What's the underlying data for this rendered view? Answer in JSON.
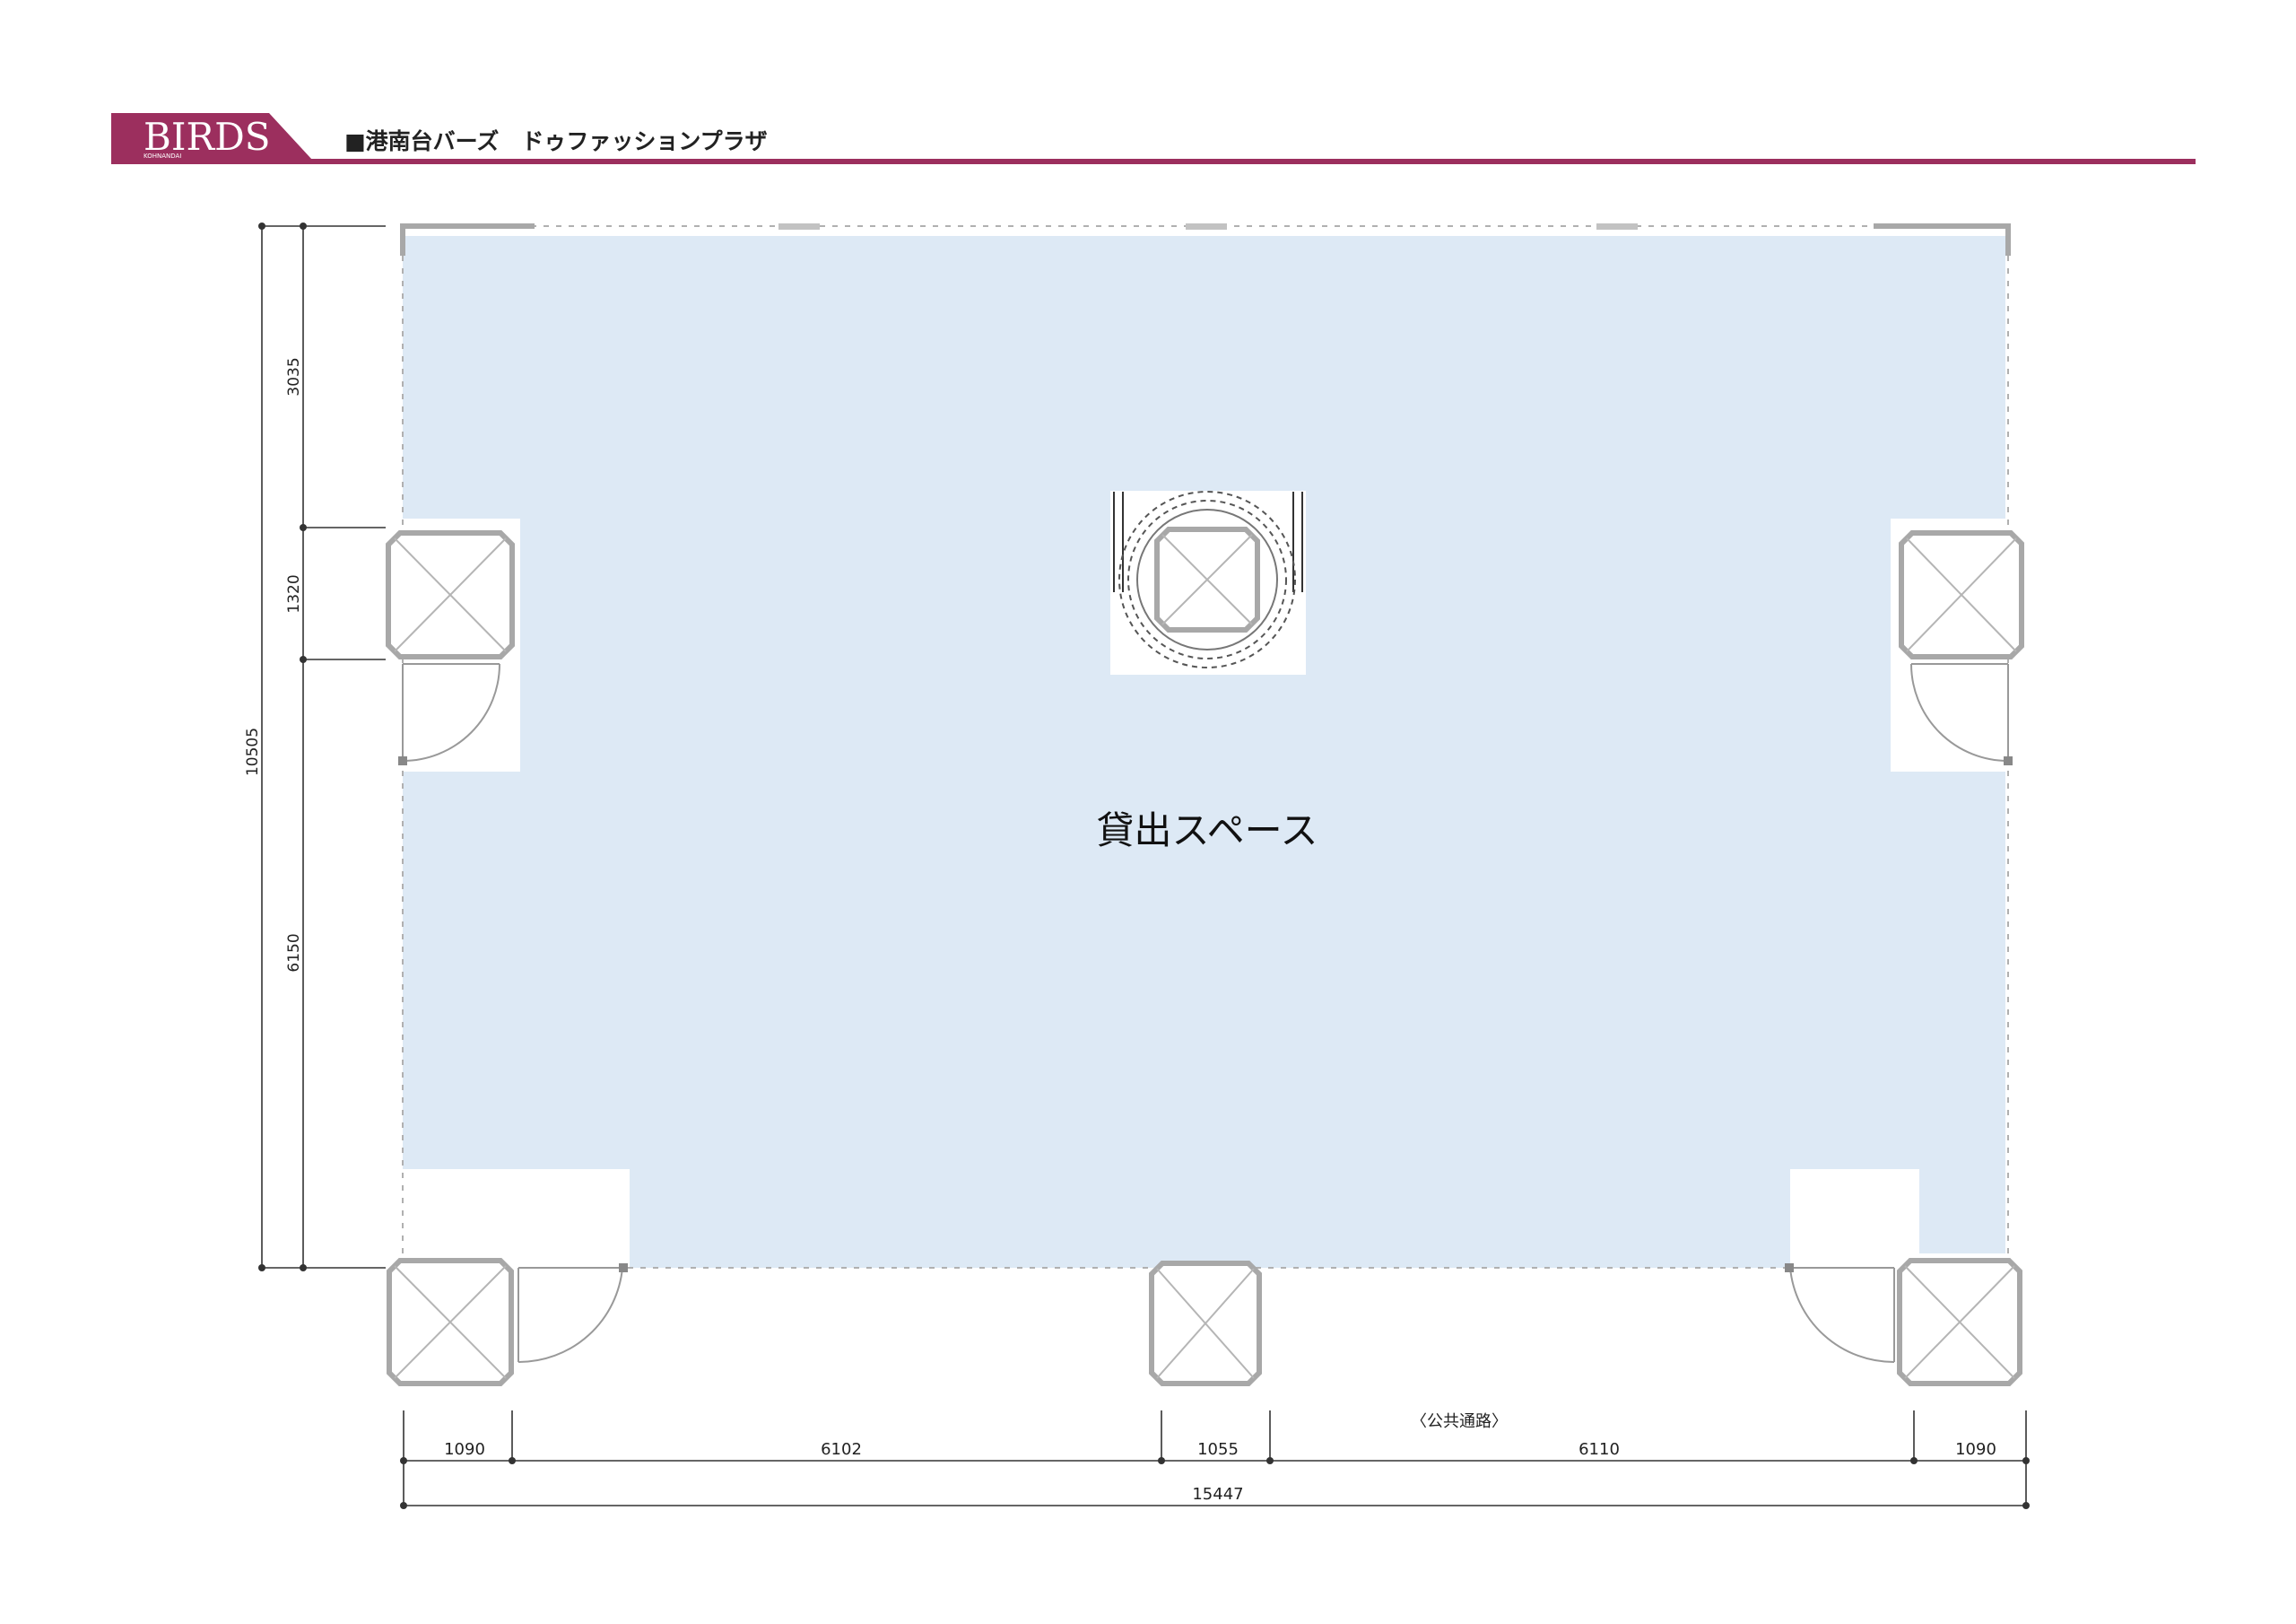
{
  "header": {
    "logo_text": "BIRDS",
    "logo_subtext": "KOHNANDAI",
    "title": "■港南台バーズ　ドゥファッションプラザ"
  },
  "colors": {
    "brand": "#9c2f5e",
    "floor": "#dde9f5",
    "pillar_stroke": "#a8a8a8"
  },
  "room": {
    "label": "貸出スペース"
  },
  "corridor": {
    "label": "〈公共通路〉"
  },
  "dimensions": {
    "left_total": "10505",
    "left_segments": [
      "3035",
      "1320",
      "6150"
    ],
    "bottom_segments": [
      "1090",
      "6102",
      "1055",
      "6110",
      "1090"
    ],
    "bottom_total": "15447"
  },
  "icons": {
    "pillar": "pillar-icon",
    "door": "door-swing-icon",
    "escalator": "escalator-icon"
  }
}
